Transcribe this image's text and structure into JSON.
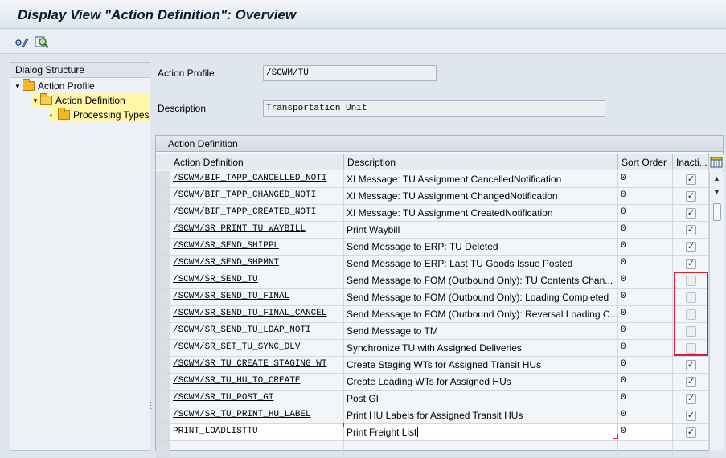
{
  "window": {
    "title": "Display View \"Action Definition\": Overview"
  },
  "toolbar": {
    "icons": [
      "display-change-icon",
      "find-icon"
    ]
  },
  "dialog_structure": {
    "title": "Dialog Structure",
    "items": [
      {
        "label": "Action Profile",
        "level": 0,
        "expanded": true
      },
      {
        "label": "Action Definition",
        "level": 1,
        "expanded": true,
        "selected": true
      },
      {
        "label": "Processing Types",
        "level": 2,
        "expanded": false
      }
    ]
  },
  "header_fields": {
    "action_profile_label": "Action Profile",
    "action_profile_value": "/SCWM/TU",
    "description_label": "Description",
    "description_value": "Transportation Unit"
  },
  "table": {
    "title": "Action Definition",
    "columns": [
      "Action Definition",
      "Description",
      "Sort Order",
      "Inacti..."
    ],
    "rows": [
      {
        "def": "/SCWM/BIF_TAPP_CANCELLED_NOTI",
        "desc": "XI Message: TU Assignment CancelledNotification",
        "sort": "0",
        "inactive": true
      },
      {
        "def": "/SCWM/BIF_TAPP_CHANGED_NOTI",
        "desc": "XI Message: TU Assignment ChangedNotification",
        "sort": "0",
        "inactive": true
      },
      {
        "def": "/SCWM/BIF_TAPP_CREATED_NOTI",
        "desc": "XI Message: TU Assignment CreatedNotification",
        "sort": "0",
        "inactive": true
      },
      {
        "def": "/SCWM/SR_PRINT_TU_WAYBILL",
        "desc": "Print Waybill",
        "sort": "0",
        "inactive": true
      },
      {
        "def": "/SCWM/SR_SEND_SHIPPL",
        "desc": "Send Message to ERP: TU Deleted",
        "sort": "0",
        "inactive": true
      },
      {
        "def": "/SCWM/SR_SEND_SHPMNT",
        "desc": "Send Message to ERP: Last TU Goods Issue Posted",
        "sort": "0",
        "inactive": true
      },
      {
        "def": "/SCWM/SR_SEND_TU",
        "desc": "Send Message to FOM (Outbound Only): TU Contents Chan...",
        "sort": "0",
        "inactive": false
      },
      {
        "def": "/SCWM/SR_SEND_TU_FINAL",
        "desc": "Send Message to FOM (Outbound Only): Loading Completed",
        "sort": "0",
        "inactive": false
      },
      {
        "def": "/SCWM/SR_SEND_TU_FINAL_CANCEL",
        "desc": "Send Message to FOM (Outbound Only): Reversal Loading C...",
        "sort": "0",
        "inactive": false
      },
      {
        "def": "/SCWM/SR_SEND_TU_LDAP_NOTI",
        "desc": "Send Message to TM",
        "sort": "0",
        "inactive": false
      },
      {
        "def": "/SCWM/SR_SET_TU_SYNC_DLV",
        "desc": "Synchronize TU with Assigned Deliveries",
        "sort": "0",
        "inactive": false
      },
      {
        "def": "/SCWM/SR_TU_CREATE_STAGING_WT",
        "desc": "Create Staging WTs for Assigned Transit HUs",
        "sort": "0",
        "inactive": true
      },
      {
        "def": "/SCWM/SR_TU_HU_TO_CREATE",
        "desc": "Create Loading WTs for Assigned HUs",
        "sort": "0",
        "inactive": true
      },
      {
        "def": "/SCWM/SR_TU_POST_GI",
        "desc": "Post GI",
        "sort": "0",
        "inactive": true
      },
      {
        "def": "/SCWM/SR_TU_PRINT_HU_LABEL",
        "desc": "Print HU Labels for Assigned Transit HUs",
        "sort": "0",
        "inactive": true
      },
      {
        "def": "PRINT_LOADLISTTU",
        "desc": "Print Freight List",
        "sort": "0",
        "inactive": true
      }
    ]
  },
  "colors": {
    "highlight_box": "#d9202a",
    "tree_selected": "#fff6a8",
    "folder": "#f2b829"
  }
}
